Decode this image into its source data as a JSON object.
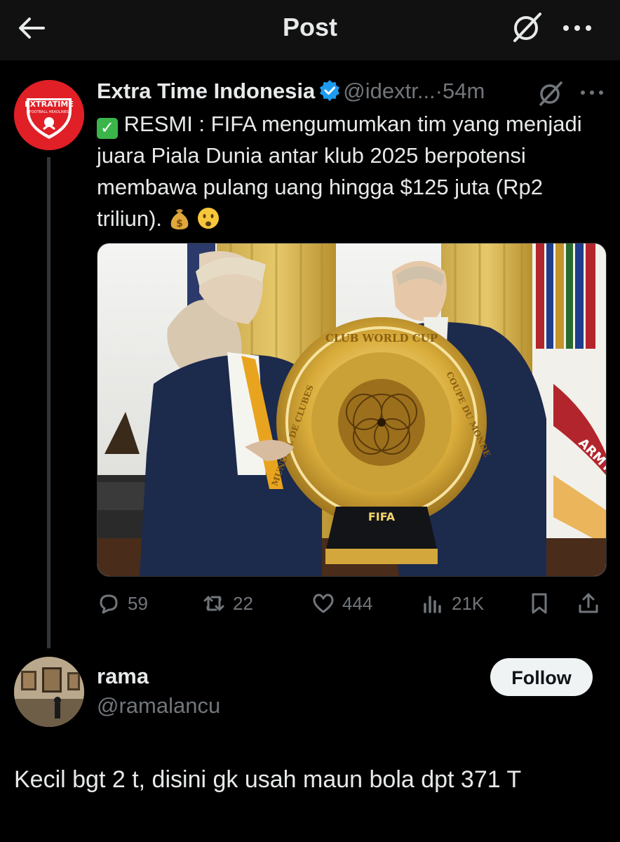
{
  "header": {
    "title": "Post",
    "back_icon": "arrow-left-icon",
    "grok_icon": "grok-icon",
    "more_icon": "more-horizontal-icon"
  },
  "tweet": {
    "author_name": "Extra Time Indonesia",
    "author_handle": "@idextr...",
    "separator": "·",
    "time": "54m",
    "avatar_text": "EXTRATIME",
    "avatar_subtext": "FOOTBALL HEADLINES",
    "text_check": "✓",
    "text": "RESMI : FIFA mengumumkan tim yang menjadi juara Piala Dunia antar klub 2025 berpotensi membawa pulang uang hingga $125 juta (Rp2 triliun).",
    "media": {
      "trophy_top_text": "CLUB WORLD CUP",
      "trophy_right_text": "COUPE DU MONDE",
      "trophy_left_text": "MUNDIAL DE CLUBES",
      "trophy_base_text": "FIFA",
      "flag_text": "ARMY"
    },
    "stats": {
      "replies": "59",
      "reposts": "22",
      "likes": "444",
      "views": "21K"
    }
  },
  "reply_user": {
    "name": "rama",
    "handle": "@ramalancu",
    "follow_label": "Follow"
  },
  "reply": {
    "text": "Kecil bgt 2 t, disini gk usah maun bola dpt 371 T"
  },
  "colors": {
    "background": "#000000",
    "topbar": "#111111",
    "text_primary": "#e7e9ea",
    "text_secondary": "#71767b",
    "verified_blue": "#1d9bf0",
    "avatar_red": "#e01f26"
  }
}
